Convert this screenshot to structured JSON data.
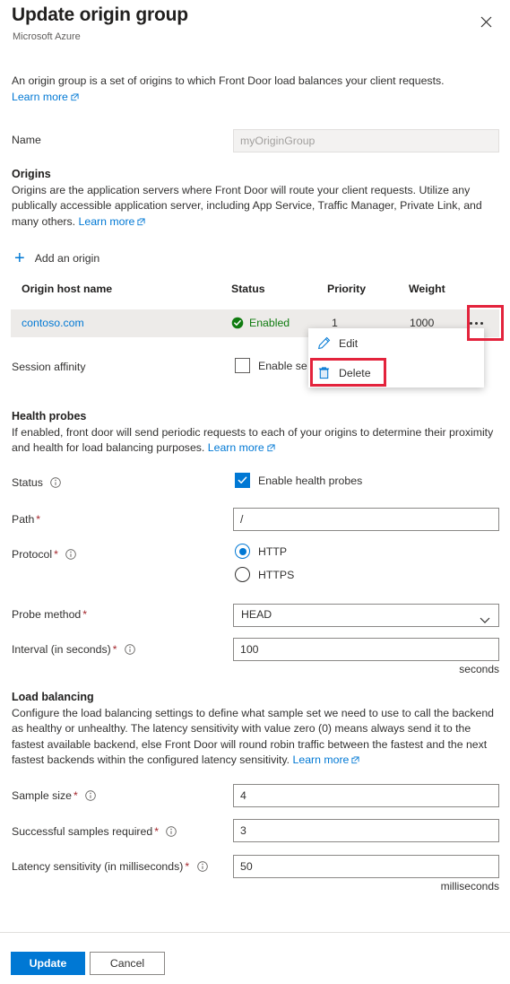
{
  "header": {
    "title": "Update origin group",
    "subtitle": "Microsoft Azure",
    "close_icon": "close-icon"
  },
  "intro": {
    "text": "An origin group is a set of origins to which Front Door load balances your client requests.",
    "learn_more": "Learn more"
  },
  "name_row": {
    "label": "Name",
    "value": "myOriginGroup",
    "disabled": true
  },
  "origins": {
    "heading": "Origins",
    "description": "Origins are the application servers where Front Door will route your client requests. Utilize any publically accessible application server, including App Service, Traffic Manager, Private Link, and many others.",
    "learn_more": "Learn more",
    "add_button": "Add an origin",
    "add_icon": "plus-icon",
    "columns": [
      "Origin host name",
      "Status",
      "Priority",
      "Weight"
    ],
    "rows": [
      {
        "host": "contoso.com",
        "status": "Enabled",
        "status_icon": "check-circle-icon",
        "status_color": "#107c10",
        "priority": "1",
        "weight": "1000",
        "more_icon": "ellipsis-icon"
      }
    ]
  },
  "context_menu": {
    "items": [
      {
        "label": "Edit",
        "icon": "pencil-icon",
        "highlighted": false
      },
      {
        "label": "Delete",
        "icon": "trash-icon",
        "highlighted": true
      }
    ],
    "highlight_color": "#e3233c"
  },
  "session_affinity": {
    "label": "Session affinity",
    "checkbox_label": "Enable se",
    "checked": false
  },
  "health_probes": {
    "heading": "Health probes",
    "description": "If enabled, front door will send periodic requests to each of your origins to determine their proximity and health for load balancing purposes.",
    "learn_more": "Learn more",
    "status": {
      "label": "Status",
      "info_icon": "info-icon",
      "checkbox_label": "Enable health probes",
      "checked": true
    },
    "path": {
      "label": "Path",
      "required": "*",
      "value": "/"
    },
    "protocol": {
      "label": "Protocol",
      "required": "*",
      "info_icon": "info-icon",
      "options": [
        "HTTP",
        "HTTPS"
      ],
      "selected": "HTTP"
    },
    "probe_method": {
      "label": "Probe method",
      "required": "*",
      "value": "HEAD",
      "chevron_icon": "chevron-down-icon"
    },
    "interval": {
      "label": "Interval (in seconds)",
      "required": "*",
      "info_icon": "info-icon",
      "value": "100",
      "unit": "seconds"
    }
  },
  "load_balancing": {
    "heading": "Load balancing",
    "description": "Configure the load balancing settings to define what sample set we need to use to call the backend as healthy or unhealthy. The latency sensitivity with value zero (0) means always send it to the fastest available backend, else Front Door will round robin traffic between the fastest and the next fastest backends within the configured latency sensitivity.",
    "learn_more": "Learn more",
    "sample_size": {
      "label": "Sample size",
      "required": "*",
      "info_icon": "info-icon",
      "value": "4"
    },
    "successful_samples": {
      "label": "Successful samples required",
      "required": "*",
      "info_icon": "info-icon",
      "value": "3"
    },
    "latency_sensitivity": {
      "label": "Latency sensitivity (in milliseconds)",
      "required": "*",
      "info_icon": "info-icon",
      "value": "50",
      "unit": "milliseconds"
    }
  },
  "footer": {
    "update_label": "Update",
    "cancel_label": "Cancel",
    "primary_color": "#0078d4"
  }
}
